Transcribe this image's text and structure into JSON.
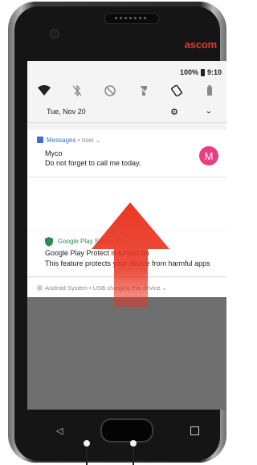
{
  "device": {
    "brand": "ascom"
  },
  "status_bar": {
    "battery": "100%",
    "time": "9:10"
  },
  "quick_settings": {
    "icons": [
      "wifi-icon",
      "bluetooth-off-icon",
      "dnd-icon",
      "flashlight-icon",
      "auto-rotate-icon",
      "battery-saver-icon"
    ]
  },
  "date_row": {
    "date": "Tue, Nov 20"
  },
  "notifications": [
    {
      "app": "Messages",
      "meta": " • now ⌄",
      "title": "Myco",
      "body": "Do not forget to call me today.",
      "avatar_letter": "M",
      "avatar_color": "#ea3e83"
    },
    {
      "app": "Google Play Store • 2h ⌄",
      "title": "Google Play Protect is turned on",
      "body": "This feature protects your device from harmful apps"
    },
    {
      "app": "Android System • USB charging this device ⌄"
    }
  ],
  "colors": {
    "arrow": "#e9321f",
    "brand": "#e23b2d",
    "messages_accent": "#3b6fd3",
    "play_accent": "#2e8b57"
  }
}
